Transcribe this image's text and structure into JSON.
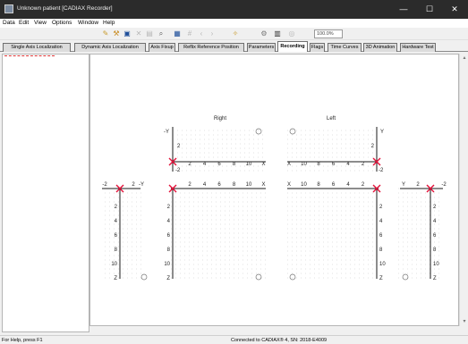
{
  "window": {
    "title": "Unknown patient [CADIAX Recorder]",
    "minimize": "—",
    "maximize": "☐",
    "close": "✕"
  },
  "menu": [
    "Data",
    "Edit",
    "View",
    "Options",
    "Window",
    "Help"
  ],
  "toolbar": {
    "zoom_value": "100.0%"
  },
  "tabs": [
    "Single Axis Localization",
    "Dynamic Axis Localization",
    "Axis Fixup",
    "Reflix Reference Position",
    "Parameters",
    "Recording",
    "Flags",
    "Time Curves",
    "3D Animation",
    "Hardware Test"
  ],
  "active_tab": "Recording",
  "charts": {
    "right_label": "Right",
    "left_label": "Left",
    "xticks_right": [
      "2",
      "4",
      "6",
      "8",
      "10",
      "X"
    ],
    "xticks_left": [
      "X",
      "10",
      "8",
      "6",
      "4",
      "2"
    ],
    "y_top_label": "-Y",
    "y_top_label_left": "Y",
    "y_top_ticks": [
      "2"
    ],
    "y_top_neg_ticks": [
      "-2"
    ],
    "z_ticks": [
      "2",
      "4",
      "6",
      "8",
      "10",
      "Z"
    ],
    "side_left_x": [
      "-2",
      "2",
      "-Y"
    ],
    "side_right_x": [
      "Y",
      "2",
      "-2"
    ]
  },
  "status": {
    "help": "For Help, press F1",
    "connection": "Connected to CADIAX® 4, SN: 2018-E4009"
  },
  "colors": {
    "marker": "#e3123a",
    "axis": "#1a1a1a",
    "grid": "#9a9a9a",
    "titlebar": "#2b2b2b"
  }
}
